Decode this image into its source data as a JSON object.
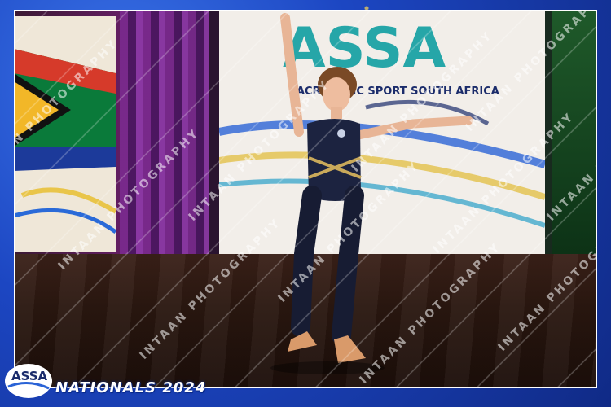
{
  "image": {
    "banner_logo_text": "ASSA",
    "banner_subtitle": "ACROBATIC SPORT SOUTH AFRICA",
    "watermark_text": "INTAAN PHOTOGRAPHY",
    "footer_event_text": "NATIONALS 2024",
    "footer_logo_text": "ASSA",
    "colors": {
      "frame_blue": "#1c46c2",
      "frame_gold": "#ffd750",
      "leotard_navy": "#1c2340",
      "leotard_trim": "#c9a95a",
      "banner_teal": "#26a6a8",
      "banner_navy": "#1b2c6b"
    }
  }
}
